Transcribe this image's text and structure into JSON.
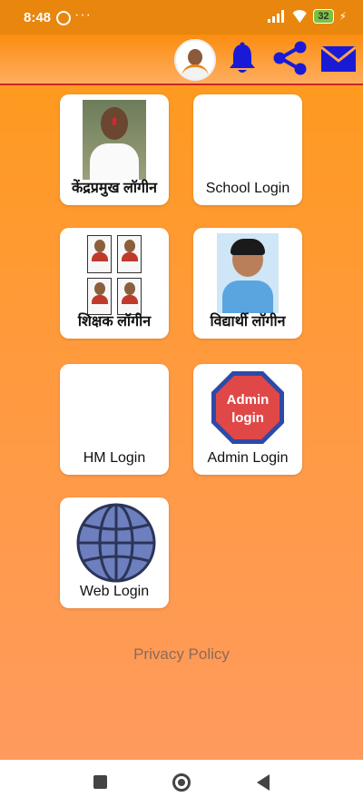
{
  "status_bar": {
    "time": "8:48",
    "dots": "···",
    "battery": "32",
    "bolt": "⚡"
  },
  "header": {
    "avatar": "profile-avatar",
    "icons": [
      "bell-icon",
      "share-icon",
      "mail-icon"
    ],
    "accent_color": "#1a1ad6",
    "divider_color": "#c62828"
  },
  "tiles": [
    {
      "label": "केंद्रप्रमुख लॉगीन"
    },
    {
      "label": "School Login"
    },
    {
      "label": "शिक्षक लॉगीन"
    },
    {
      "label": "विद्यार्थी लॉगीन"
    },
    {
      "label": "HM Login"
    },
    {
      "label": "Admin Login",
      "badge_text_1": "Admin",
      "badge_text_2": "login"
    },
    {
      "label": "Web Login"
    }
  ],
  "footer": {
    "privacy_label": "Privacy Policy"
  },
  "colors": {
    "background": "#ff9a30",
    "card": "#ffffff"
  }
}
